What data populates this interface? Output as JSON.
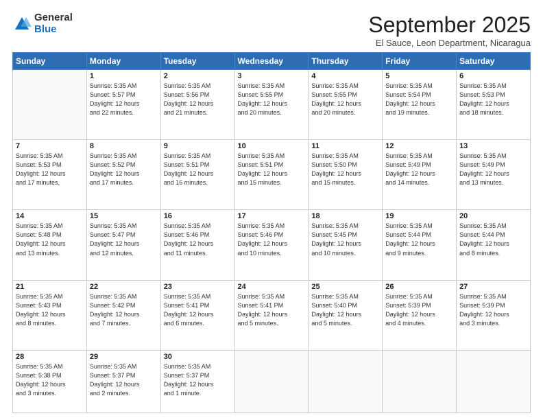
{
  "logo": {
    "general": "General",
    "blue": "Blue"
  },
  "header": {
    "month": "September 2025",
    "location": "El Sauce, Leon Department, Nicaragua"
  },
  "weekdays": [
    "Sunday",
    "Monday",
    "Tuesday",
    "Wednesday",
    "Thursday",
    "Friday",
    "Saturday"
  ],
  "weeks": [
    [
      {
        "day": "",
        "info": ""
      },
      {
        "day": "1",
        "info": "Sunrise: 5:35 AM\nSunset: 5:57 PM\nDaylight: 12 hours\nand 22 minutes."
      },
      {
        "day": "2",
        "info": "Sunrise: 5:35 AM\nSunset: 5:56 PM\nDaylight: 12 hours\nand 21 minutes."
      },
      {
        "day": "3",
        "info": "Sunrise: 5:35 AM\nSunset: 5:55 PM\nDaylight: 12 hours\nand 20 minutes."
      },
      {
        "day": "4",
        "info": "Sunrise: 5:35 AM\nSunset: 5:55 PM\nDaylight: 12 hours\nand 20 minutes."
      },
      {
        "day": "5",
        "info": "Sunrise: 5:35 AM\nSunset: 5:54 PM\nDaylight: 12 hours\nand 19 minutes."
      },
      {
        "day": "6",
        "info": "Sunrise: 5:35 AM\nSunset: 5:53 PM\nDaylight: 12 hours\nand 18 minutes."
      }
    ],
    [
      {
        "day": "7",
        "info": "Sunrise: 5:35 AM\nSunset: 5:53 PM\nDaylight: 12 hours\nand 17 minutes."
      },
      {
        "day": "8",
        "info": "Sunrise: 5:35 AM\nSunset: 5:52 PM\nDaylight: 12 hours\nand 17 minutes."
      },
      {
        "day": "9",
        "info": "Sunrise: 5:35 AM\nSunset: 5:51 PM\nDaylight: 12 hours\nand 16 minutes."
      },
      {
        "day": "10",
        "info": "Sunrise: 5:35 AM\nSunset: 5:51 PM\nDaylight: 12 hours\nand 15 minutes."
      },
      {
        "day": "11",
        "info": "Sunrise: 5:35 AM\nSunset: 5:50 PM\nDaylight: 12 hours\nand 15 minutes."
      },
      {
        "day": "12",
        "info": "Sunrise: 5:35 AM\nSunset: 5:49 PM\nDaylight: 12 hours\nand 14 minutes."
      },
      {
        "day": "13",
        "info": "Sunrise: 5:35 AM\nSunset: 5:49 PM\nDaylight: 12 hours\nand 13 minutes."
      }
    ],
    [
      {
        "day": "14",
        "info": "Sunrise: 5:35 AM\nSunset: 5:48 PM\nDaylight: 12 hours\nand 13 minutes."
      },
      {
        "day": "15",
        "info": "Sunrise: 5:35 AM\nSunset: 5:47 PM\nDaylight: 12 hours\nand 12 minutes."
      },
      {
        "day": "16",
        "info": "Sunrise: 5:35 AM\nSunset: 5:46 PM\nDaylight: 12 hours\nand 11 minutes."
      },
      {
        "day": "17",
        "info": "Sunrise: 5:35 AM\nSunset: 5:46 PM\nDaylight: 12 hours\nand 10 minutes."
      },
      {
        "day": "18",
        "info": "Sunrise: 5:35 AM\nSunset: 5:45 PM\nDaylight: 12 hours\nand 10 minutes."
      },
      {
        "day": "19",
        "info": "Sunrise: 5:35 AM\nSunset: 5:44 PM\nDaylight: 12 hours\nand 9 minutes."
      },
      {
        "day": "20",
        "info": "Sunrise: 5:35 AM\nSunset: 5:44 PM\nDaylight: 12 hours\nand 8 minutes."
      }
    ],
    [
      {
        "day": "21",
        "info": "Sunrise: 5:35 AM\nSunset: 5:43 PM\nDaylight: 12 hours\nand 8 minutes."
      },
      {
        "day": "22",
        "info": "Sunrise: 5:35 AM\nSunset: 5:42 PM\nDaylight: 12 hours\nand 7 minutes."
      },
      {
        "day": "23",
        "info": "Sunrise: 5:35 AM\nSunset: 5:41 PM\nDaylight: 12 hours\nand 6 minutes."
      },
      {
        "day": "24",
        "info": "Sunrise: 5:35 AM\nSunset: 5:41 PM\nDaylight: 12 hours\nand 5 minutes."
      },
      {
        "day": "25",
        "info": "Sunrise: 5:35 AM\nSunset: 5:40 PM\nDaylight: 12 hours\nand 5 minutes."
      },
      {
        "day": "26",
        "info": "Sunrise: 5:35 AM\nSunset: 5:39 PM\nDaylight: 12 hours\nand 4 minutes."
      },
      {
        "day": "27",
        "info": "Sunrise: 5:35 AM\nSunset: 5:39 PM\nDaylight: 12 hours\nand 3 minutes."
      }
    ],
    [
      {
        "day": "28",
        "info": "Sunrise: 5:35 AM\nSunset: 5:38 PM\nDaylight: 12 hours\nand 3 minutes."
      },
      {
        "day": "29",
        "info": "Sunrise: 5:35 AM\nSunset: 5:37 PM\nDaylight: 12 hours\nand 2 minutes."
      },
      {
        "day": "30",
        "info": "Sunrise: 5:35 AM\nSunset: 5:37 PM\nDaylight: 12 hours\nand 1 minute."
      },
      {
        "day": "",
        "info": ""
      },
      {
        "day": "",
        "info": ""
      },
      {
        "day": "",
        "info": ""
      },
      {
        "day": "",
        "info": ""
      }
    ]
  ]
}
